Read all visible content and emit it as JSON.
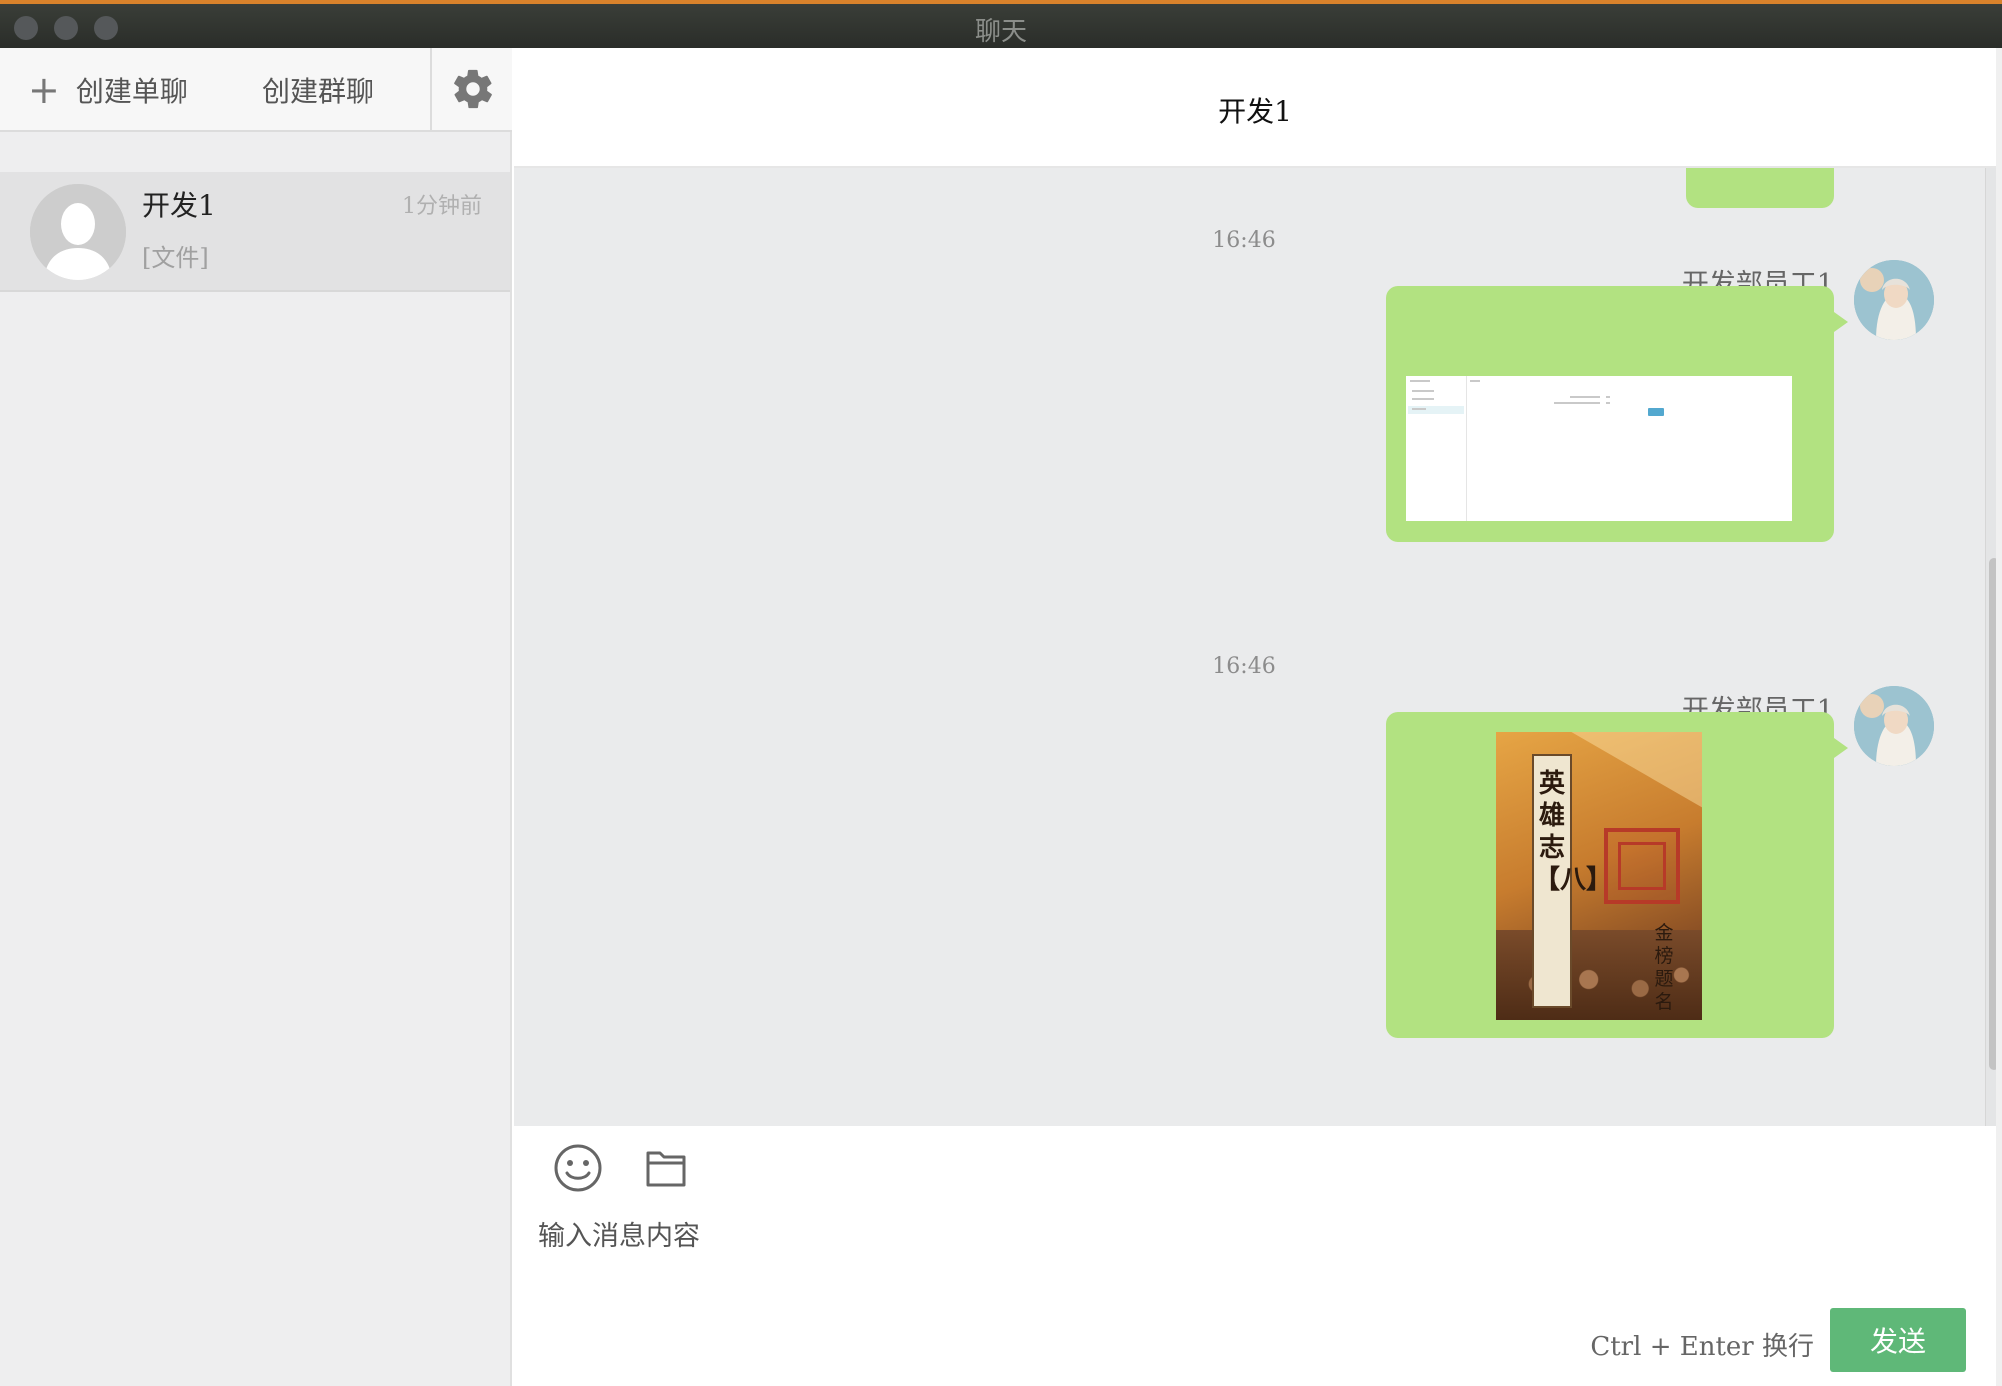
{
  "window": {
    "title": "聊天"
  },
  "sidebar": {
    "create_single_label": "创建单聊",
    "create_group_label": "创建群聊",
    "settings_icon": "gear-icon",
    "conversations": [
      {
        "name": "开发1",
        "time": "1分钟前",
        "preview": "[文件]"
      }
    ]
  },
  "chat": {
    "title": "开发1",
    "messages": [
      {
        "time": "16:46",
        "sender": "开发部员工1",
        "type": "image-screenshot"
      },
      {
        "time": "16:46",
        "sender": "开发部员工1",
        "type": "image-poster",
        "poster_title": "英雄志【八】",
        "poster_subtitle": "金榜题名"
      }
    ]
  },
  "composer": {
    "emoji_icon": "smile-icon",
    "file_icon": "folder-icon",
    "placeholder": "输入消息内容",
    "hint": "Ctrl + Enter 换行",
    "send_label": "发送"
  },
  "colors": {
    "bubble": "#b2e281",
    "send": "#5fb878",
    "titlebar_accent": "#d9822b"
  }
}
